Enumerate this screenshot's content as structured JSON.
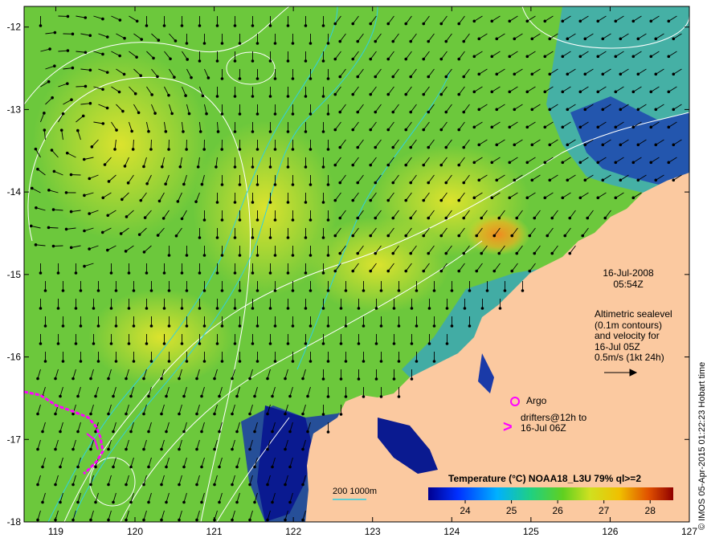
{
  "map": {
    "longitude_ticks": [
      "119",
      "120",
      "121",
      "122",
      "123",
      "124",
      "125",
      "126",
      "127"
    ],
    "latitude_ticks": [
      "-12",
      "-13",
      "-14",
      "-15",
      "-16",
      "-17",
      "-18"
    ],
    "lon_range": [
      118.6,
      127
    ],
    "lat_range": [
      -18,
      -11.75
    ]
  },
  "annotation": {
    "date": "16-Jul-2008",
    "time": "05:54Z",
    "altimetric_lines": [
      "Altimetric sealevel",
      "(0.1m contours)",
      "and velocity for",
      "16-Jul 05Z",
      "0.5m/s (1kt 24h)"
    ],
    "argo_label": "Argo",
    "drifters_lines": [
      "drifters@12h to",
      "16-Jul 06Z"
    ],
    "drifter_marker": ">"
  },
  "colorbar": {
    "title": "Temperature (°C) NOAA18_L3U 79% ql>=2",
    "ticks": [
      "24",
      "25",
      "26",
      "27",
      "28"
    ],
    "min": 23.2,
    "max": 28.5
  },
  "depth_legend": "200  1000m",
  "copyright": "© IMOS 05-Apr-2015 01:22:23 Hobart time",
  "colors": {
    "land": "#fbc9a0",
    "ocean_warm": "#e2e62a",
    "ocean_mid": "#68c83a",
    "ocean_cool": "#1e90e0",
    "ocean_cold": "#0a1a9a",
    "hot_spot": "#f08a20",
    "contour_depth": "#30d0e0",
    "contour_sealevel": "#ffffff",
    "marker": "#ff00ff"
  }
}
